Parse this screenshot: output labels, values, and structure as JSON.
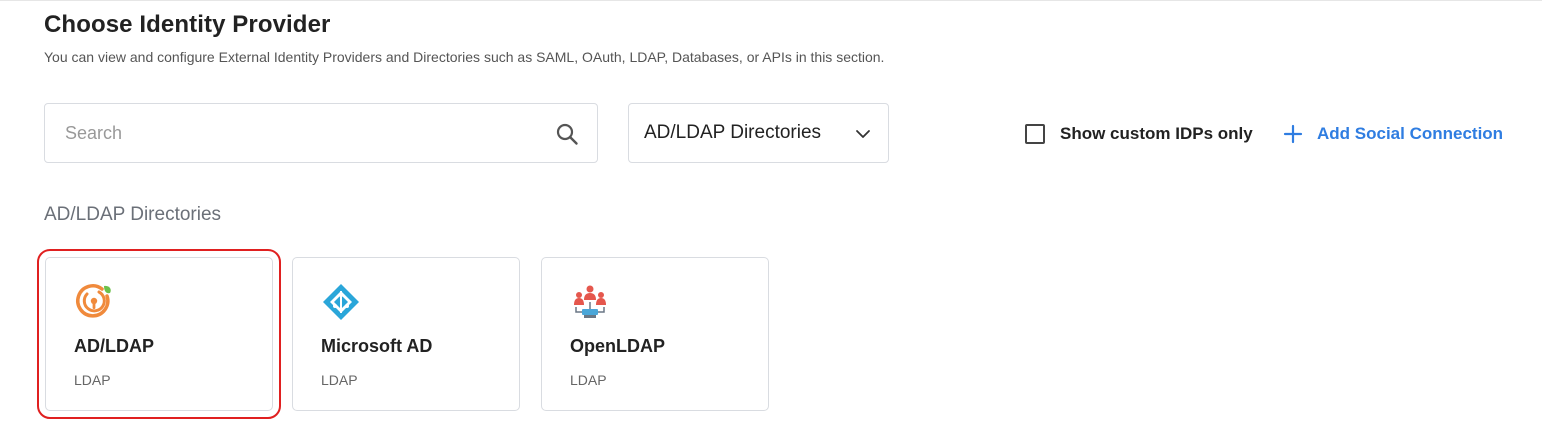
{
  "header": {
    "title": "Choose Identity Provider",
    "subtitle": "You can view and configure External Identity Providers and Directories such as SAML, OAuth, LDAP, Databases, or APIs in this section."
  },
  "toolbar": {
    "search_placeholder": "Search",
    "search_icon": "search-icon",
    "filter_selected": "AD/LDAP Directories",
    "custom_idps_label": "Show custom IDPs only",
    "custom_idps_checked": false,
    "add_social_label": "Add Social Connection",
    "accent_color": "#2f7de1"
  },
  "section": {
    "heading": "AD/LDAP Directories"
  },
  "cards": [
    {
      "name": "AD/LDAP",
      "type": "LDAP",
      "icon": "adldap-logo-icon",
      "highlighted": true
    },
    {
      "name": "Microsoft AD",
      "type": "LDAP",
      "icon": "microsoft-ad-logo-icon",
      "highlighted": false
    },
    {
      "name": "OpenLDAP",
      "type": "LDAP",
      "icon": "openldap-logo-icon",
      "highlighted": false
    }
  ],
  "highlight_color": "#e02020"
}
